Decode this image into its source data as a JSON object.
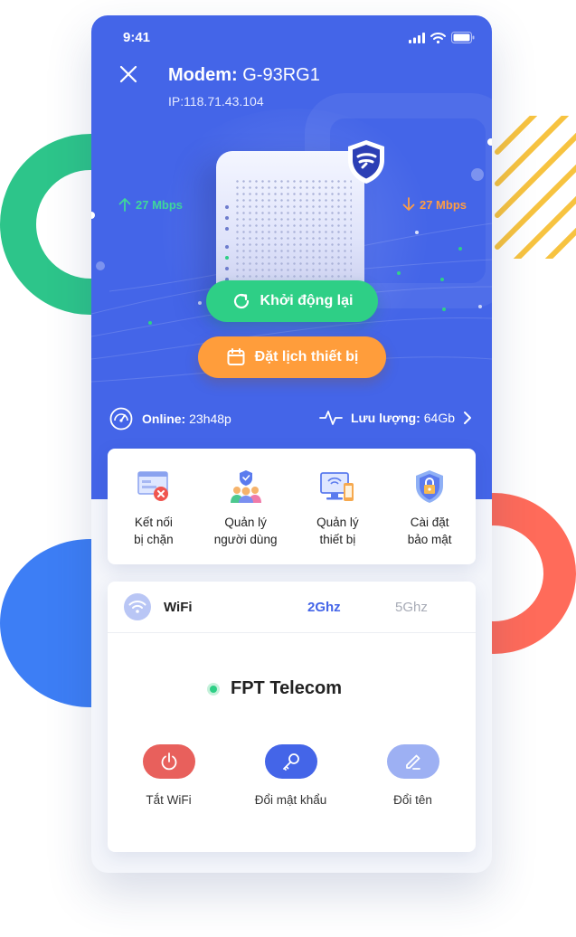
{
  "status_bar": {
    "time": "9:41"
  },
  "header": {
    "title_label": "Modem:",
    "title_value": "G-93RG1",
    "ip": "IP:118.71.43.104"
  },
  "speeds": {
    "upload": "27 Mbps",
    "download": "27 Mbps"
  },
  "buttons": {
    "restart": "Khởi động lại",
    "schedule": "Đặt lịch thiết bị"
  },
  "stats": {
    "online_label": "Online:",
    "online_value": "23h48p",
    "traffic_label": "Lưu lượng:",
    "traffic_value": "64Gb"
  },
  "quick_actions": [
    {
      "label": "Kết nối\nbị chặn",
      "icon": "blocked-connection-icon"
    },
    {
      "label": "Quản lý\nngười dùng",
      "icon": "user-management-icon"
    },
    {
      "label": "Quản lý\nthiết bị",
      "icon": "device-management-icon"
    },
    {
      "label": "Cài đặt\nbảo mật",
      "icon": "security-settings-icon"
    }
  ],
  "wifi": {
    "title": "WiFi",
    "tabs": [
      "2Ghz",
      "5Ghz"
    ],
    "active_tab": "2Ghz",
    "ssid": "FPT Telecom",
    "actions": [
      {
        "label": "Tắt WiFi",
        "icon": "power-icon",
        "color": "#e8605c"
      },
      {
        "label": "Đổi mật khẩu",
        "icon": "key-icon",
        "color": "#4465e8"
      },
      {
        "label": "Đổi tên",
        "icon": "edit-icon",
        "color": "#9db0f3"
      }
    ]
  },
  "colors": {
    "primary": "#4465e8",
    "green": "#2ecf86",
    "orange": "#ff9d3b",
    "upload": "#3fd79b",
    "download": "#ff9d43"
  }
}
